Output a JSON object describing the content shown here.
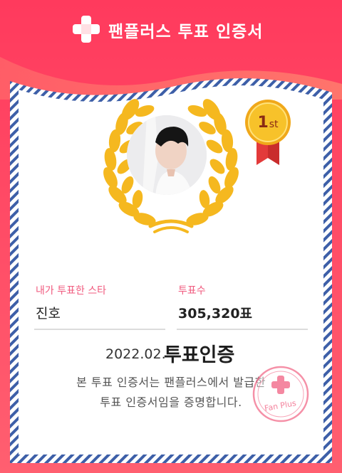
{
  "header": {
    "title": "팬플러스 투표 인증서",
    "logo_icon": "cross-plus-icon"
  },
  "certificate": {
    "rank": {
      "main": "1",
      "suffix": "st"
    },
    "star_label": "내가 투표한 스타",
    "star_name": "진호",
    "votes_label": "투표수",
    "votes_value": "305,320표",
    "date": "2022.02.",
    "cert_word": "투표인증",
    "body_line1": "본 투표 인증서는 팬플러스에서 발급한",
    "body_line2": "투표 인증서임을 증명합니다.",
    "stamp_text": "Fan Plus"
  },
  "colors": {
    "header_top": "#ff3f5e",
    "header_bottom": "#ff6f7c",
    "label_pink": "#f05a7e",
    "stripe_blue": "#3d5fa8",
    "laurel_gold": "#f5b81f",
    "medal_gold": "#f7c22a",
    "ribbon_red": "#e33a3a",
    "stamp_pink": "#f26b8a"
  }
}
